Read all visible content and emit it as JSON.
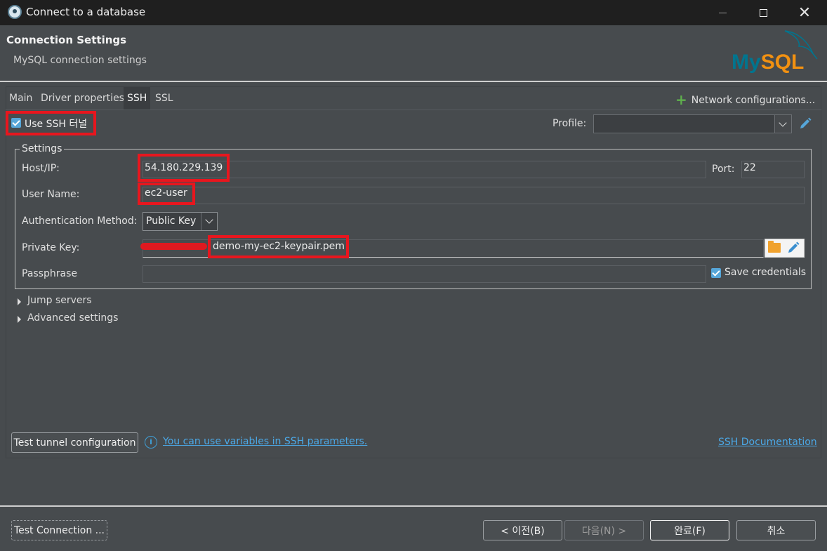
{
  "window": {
    "title": "Connect to a database"
  },
  "header": {
    "title": "Connection Settings",
    "subtitle": "MySQL connection settings",
    "logo_my": "My",
    "logo_sql": "SQL"
  },
  "tabs": [
    {
      "label": "Main"
    },
    {
      "label": "Driver properties"
    },
    {
      "label": "SSH",
      "active": true
    },
    {
      "label": "SSL"
    }
  ],
  "network_config_label": "Network configurations...",
  "ssh": {
    "use_ssh_label": "Use SSH 터널",
    "use_ssh_checked": true,
    "profile_label": "Profile:",
    "profile_value": ""
  },
  "settings": {
    "legend": "Settings",
    "host_label": "Host/IP:",
    "host_value": "54.180.229.139",
    "port_label": "Port:",
    "port_value": "22",
    "user_label": "User Name:",
    "user_value": "ec2-user",
    "auth_label": "Authentication Method:",
    "auth_value": "Public Key",
    "private_key_label": "Private Key:",
    "private_key_value": "demo-my-ec2-keypair.pem",
    "passphrase_label": "Passphrase",
    "passphrase_value": "",
    "save_credentials_label": "Save credentials",
    "save_credentials_checked": true
  },
  "expanders": {
    "jump_servers": "Jump servers",
    "advanced_settings": "Advanced settings"
  },
  "bottom": {
    "test_tunnel_label": "Test tunnel configuration",
    "variables_link": "You can use variables in SSH parameters.",
    "ssh_doc_link": "SSH Documentation"
  },
  "footer": {
    "test_connection_label": "Test Connection ...",
    "back_label": "< 이전(B)",
    "next_label": "다음(N) >",
    "finish_label": "완료(F)",
    "cancel_label": "취소"
  },
  "colors": {
    "accent_link": "#4ba8e6",
    "highlight_red": "#e8161e",
    "checkbox_blue": "#56a6d9",
    "mysql_blue": "#00758f",
    "mysql_orange": "#f29111"
  }
}
